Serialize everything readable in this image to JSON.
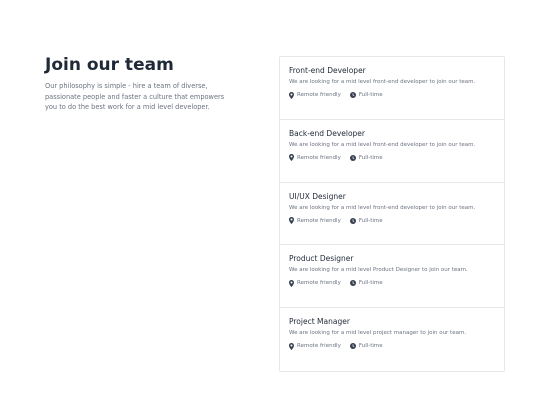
{
  "intro": {
    "heading": "Join our team",
    "text": "Our philosophy is simple - hire a team of diverse, passionate people and faster a culture that empowers you to do the best work for a mid level developer."
  },
  "jobs": [
    {
      "title": "Front-end Developer",
      "description": "We are looking for a mid level front-end developer to join our team.",
      "location": "Remote friendly",
      "type": "Full-time"
    },
    {
      "title": "Back-end Developer",
      "description": "We are looking for a mid level front-end developer to join our team.",
      "location": "Remote friendly",
      "type": "Full-time"
    },
    {
      "title": "UI/UX Designer",
      "description": "We are looking for a mid level front-end developer to join our team.",
      "location": "Remote friendly",
      "type": "Full-time"
    },
    {
      "title": "Product Designer",
      "description": "We are looking for a mid level Product Designer to join our team.",
      "location": "Remote friendly",
      "type": "Full-time"
    },
    {
      "title": "Project Manager",
      "description": "We are looking for a mid level project manager to join our team.",
      "location": "Remote friendly",
      "type": "Full-time"
    }
  ],
  "icons": {
    "location": "map-pin-icon",
    "type": "clock-icon"
  },
  "colors": {
    "heading": "#1f2937",
    "text": "#6b7280",
    "border": "#e5e7eb"
  }
}
